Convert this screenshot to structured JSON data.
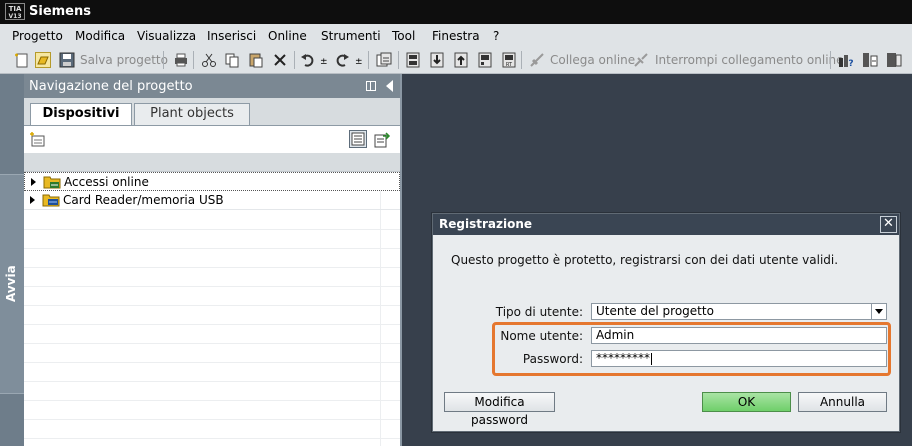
{
  "app": {
    "title": "Siemens",
    "logo_text": "TIA V13"
  },
  "menu": [
    "Progetto",
    "Modifica",
    "Visualizza",
    "Inserisci",
    "Online",
    "Strumenti",
    "Tool",
    "Finestra",
    "?"
  ],
  "toolbar": {
    "save_label": "Salva progetto",
    "connect_label": "Collega online",
    "disconnect_label": "Interrompi collegamento online",
    "icons": [
      "new-project-icon",
      "open-project-icon",
      "save-icon",
      "print-icon",
      "cut-icon",
      "copy-icon",
      "paste-icon",
      "delete-icon",
      "undo-icon",
      "redo-icon",
      "compile-icon",
      "download-icon",
      "upload-icon",
      "simulation-icon",
      "go-online-icon",
      "go-offline-icon",
      "accessible-devices-icon",
      "cross-reference-icon",
      "start-simulation-icon"
    ]
  },
  "sidebar": {
    "vertical_tab": "Avvia"
  },
  "navigation": {
    "title": "Navigazione del progetto",
    "tabs": [
      "Dispositivi",
      "Plant objects"
    ],
    "active_tab": "Dispositivi",
    "tree": [
      {
        "label": "Accessi online"
      },
      {
        "label": "Card Reader/memoria USB"
      }
    ]
  },
  "dialog": {
    "title": "Registrazione",
    "close_glyph": "✕",
    "message": "Questo progetto è protetto, registrarsi con dei dati utente validi.",
    "user_type_label": "Tipo di utente:",
    "user_type_value": "Utente del progetto",
    "username_label": "Nome utente:",
    "username_value": "Admin",
    "password_label": "Password:",
    "password_value": "*********",
    "change_password_button": "Modifica password",
    "ok_button": "OK",
    "cancel_button": "Annulla"
  },
  "colors": {
    "titlebar": "#0e0e0e",
    "menubar": "#dfe3e6",
    "workspace": "#37404c",
    "nav_header": "#7b8893",
    "highlight": "#e5772f",
    "ok_button": "#6fcf6a"
  }
}
